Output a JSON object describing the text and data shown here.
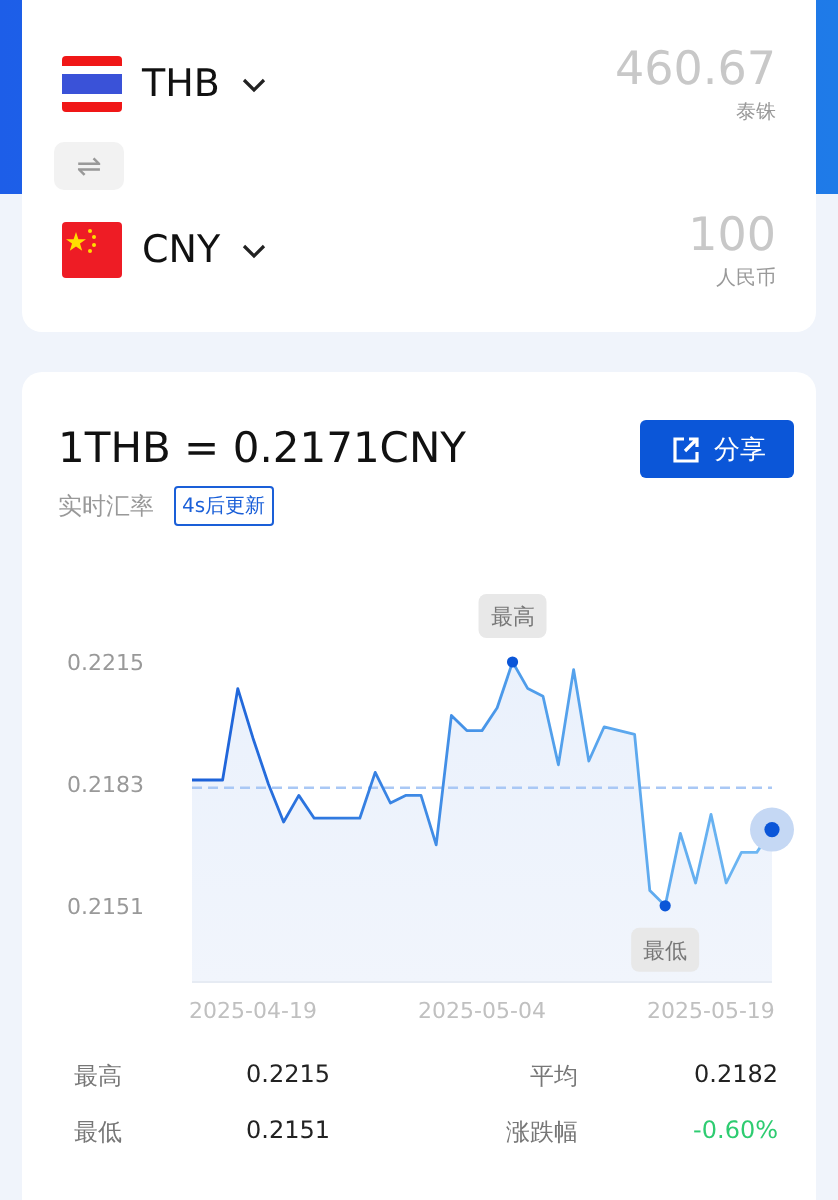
{
  "converter": {
    "rows": [
      {
        "kind": "thailand",
        "code": "THB",
        "amount": "460.67",
        "currency_name": "泰铢"
      },
      {
        "kind": "china",
        "code": "CNY",
        "amount": "100",
        "currency_name": "人民币"
      }
    ],
    "swap_icon": "⇌"
  },
  "rate_card": {
    "rate": "1THB = 0.2171CNY",
    "caption": "实时汇率",
    "refresh_badge": "4s后更新",
    "share_button": "分享",
    "chart_data": {
      "type": "area",
      "categories": [
        null,
        null,
        null,
        null,
        "2025-04-19",
        null,
        null,
        null,
        null,
        null,
        null,
        null,
        null,
        null,
        null,
        null,
        null,
        null,
        null,
        "2025-05-04",
        null,
        null,
        null,
        null,
        null,
        null,
        null,
        null,
        null,
        null,
        null,
        null,
        null,
        null,
        "2025-05-19",
        null,
        null,
        null,
        null
      ],
      "series": [
        {
          "color": "#1a5fd8",
          "values": [
            0.2184,
            0.2184,
            0.2184,
            0.2208,
            0.2195,
            0.2183,
            0.2173,
            0.218,
            0.2174,
            0.2174,
            0.2174,
            0.2174,
            0.2186,
            0.2178,
            0.218,
            0.218,
            0.2167,
            0.2201,
            0.2197,
            0.2197,
            0.2203,
            0.2215,
            0.2208,
            0.2206,
            0.2188,
            0.2213,
            0.2189,
            0.2198,
            0.2197,
            0.2196,
            0.2155,
            0.2151,
            0.217,
            0.2157,
            0.2175,
            0.2157,
            0.2165,
            0.2165,
            0.2171
          ]
        }
      ],
      "ylim": [
        0.2131,
        0.2215
      ],
      "yticks": [
        0.2151,
        0.2183,
        0.2215
      ],
      "annotations": [
        {
          "y": 0.2215,
          "text": "最高"
        },
        {
          "y": 0.2151,
          "text": "最低"
        }
      ],
      "ref_lines": [
        {
          "axis": "y",
          "value": 0.2182
        }
      ]
    },
    "stats": [
      {
        "label": "最高",
        "value": "0.2215",
        "color": "#222222"
      },
      {
        "label": "平均",
        "value": "0.2182",
        "color": "#222222"
      },
      {
        "label": "最低",
        "value": "0.2151",
        "color": "#222222"
      },
      {
        "label": "涨跌幅",
        "value": "-0.60%",
        "color": "#2ecc71"
      }
    ]
  }
}
